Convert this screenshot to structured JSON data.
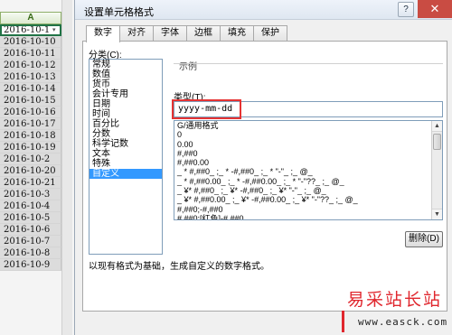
{
  "sheet": {
    "column_header": "A",
    "dates": [
      "2016-10-1",
      "2016-10-10",
      "2016-10-11",
      "2016-10-12",
      "2016-10-13",
      "2016-10-14",
      "2016-10-15",
      "2016-10-16",
      "2016-10-17",
      "2016-10-18",
      "2016-10-19",
      "2016-10-2",
      "2016-10-20",
      "2016-10-21",
      "2016-10-3",
      "2016-10-4",
      "2016-10-5",
      "2016-10-6",
      "2016-10-7",
      "2016-10-8",
      "2016-10-9"
    ]
  },
  "dialog": {
    "title": "设置单元格格式",
    "help_label": "?",
    "close_label": "✕",
    "tabs": [
      {
        "label": "数字",
        "active": true
      },
      {
        "label": "对齐",
        "active": false
      },
      {
        "label": "字体",
        "active": false
      },
      {
        "label": "边框",
        "active": false
      },
      {
        "label": "填充",
        "active": false
      },
      {
        "label": "保护",
        "active": false
      }
    ],
    "category_label": "分类(C):",
    "categories": [
      "常规",
      "数值",
      "货币",
      "会计专用",
      "日期",
      "时间",
      "百分比",
      "分数",
      "科学记数",
      "文本",
      "特殊",
      "自定义"
    ],
    "selected_category": "自定义",
    "sample_label": "示例",
    "type_label": "类型(T):",
    "type_value": "yyyy-mm-dd",
    "formats": [
      "G/通用格式",
      "0",
      "0.00",
      "#,##0",
      "#,##0.00",
      "_ * #,##0_ ;_ * -#,##0_ ;_ * \"-\"_ ;_ @_",
      "_ * #,##0.00_ ;_ * -#,##0.00_ ;_ * \"-\"??_ ;_ @_",
      "_ ¥* #,##0_ ;_ ¥* -#,##0_ ;_ ¥* \"-\"_ ;_ @_",
      "_ ¥* #,##0.00_ ;_ ¥* -#,##0.00_ ;_ ¥* \"-\"??_ ;_ @_",
      "#,##0;-#,##0",
      "#,##0;[红色]-#,##0"
    ],
    "delete_label": "删除(D)",
    "hint": "以现有格式为基础，生成自定义的数字格式。"
  },
  "watermark": {
    "text_cn": "易采站长站",
    "url": "www.easck.com"
  },
  "colors": {
    "selection": "#3399ff",
    "highlight_box": "#e53333",
    "watermark_red": "#e0272e"
  }
}
